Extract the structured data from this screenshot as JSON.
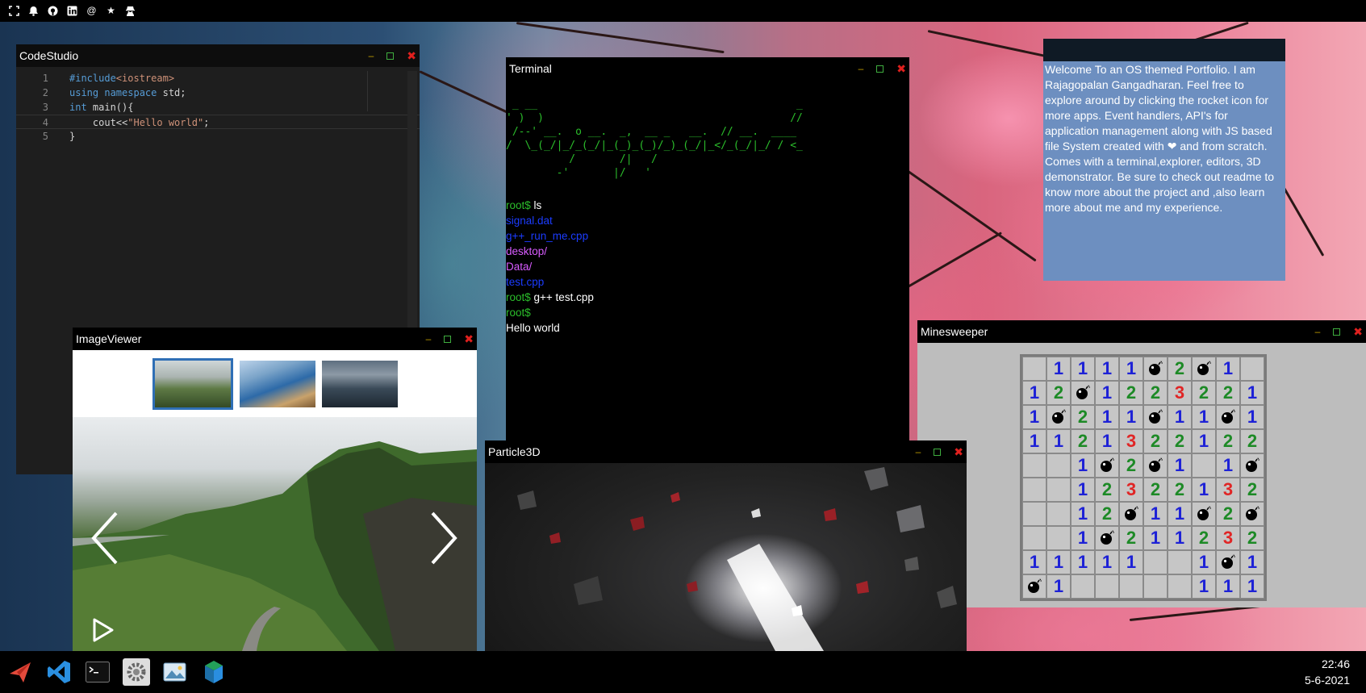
{
  "topbar": {
    "icons": [
      "fullscreen-icon",
      "bell-icon",
      "github-icon",
      "linkedin-icon",
      "at-icon",
      "star-icon",
      "spy-icon"
    ]
  },
  "windows": {
    "codestudio": {
      "title": "CodeStudio",
      "lines": [
        {
          "n": "1"
        },
        {
          "n": "2"
        },
        {
          "n": "3"
        },
        {
          "n": "4"
        },
        {
          "n": "5"
        }
      ],
      "code": {
        "l1_a": "#include",
        "l1_b": "<iostream>",
        "l2_a": "using namespace",
        "l2_b": " std;",
        "l3_a": "int",
        "l3_b": " main(){",
        "l4_a": "    cout<<",
        "l4_b": "\"Hello world\"",
        "l4_c": ";",
        "l5_a": "}"
      }
    },
    "terminal": {
      "title": "Terminal",
      "ascii_art": " _ __                                         _\n' )  )                                       //\n /--' __.  o __.  _,  __ _   __.  // __.  ____\n/  \\_(_/|_/_(_/|_(_)_(_)/_)_(_/|_</_(_/|_/ / <_\n          /       /|   /\n        -'       |/   '",
      "lines": [
        {
          "prompt": "root$",
          "text": " ls"
        },
        {
          "file": "signal.dat"
        },
        {
          "file": "g++_run_me.cpp"
        },
        {
          "dir": "desktop/"
        },
        {
          "dir": "Data/"
        },
        {
          "file": "test.cpp"
        },
        {
          "prompt": "root$",
          "text": " g++ test.cpp"
        },
        {
          "prompt": "root$",
          "text": ""
        },
        {
          "output": "Hello world"
        }
      ]
    },
    "imageviewer": {
      "title": "ImageViewer"
    },
    "particle": {
      "title": "Particle3D"
    },
    "minesweeper": {
      "title": "Minesweeper",
      "board": [
        [
          "",
          "1",
          "1",
          "1",
          "1",
          "*",
          "2",
          "*",
          "1",
          ""
        ],
        [
          "1",
          "2",
          "*",
          "1",
          "2",
          "2",
          "3",
          "2",
          "2",
          "1"
        ],
        [
          "1",
          "*",
          "2",
          "1",
          "1",
          "*",
          "1",
          "1",
          "*",
          "1"
        ],
        [
          "1",
          "1",
          "2",
          "1",
          "3",
          "2",
          "2",
          "1",
          "2",
          "2"
        ],
        [
          "",
          "",
          "1",
          "*",
          "2",
          "*",
          "1",
          "",
          "1",
          "*"
        ],
        [
          "",
          "",
          "1",
          "2",
          "3",
          "2",
          "2",
          "1",
          "3",
          "2"
        ],
        [
          "",
          "",
          "1",
          "2",
          "*",
          "1",
          "1",
          "*",
          "2",
          "*"
        ],
        [
          "",
          "",
          "1",
          "*",
          "2",
          "1",
          "1",
          "2",
          "3",
          "2"
        ],
        [
          "1",
          "1",
          "1",
          "1",
          "1",
          "",
          "",
          "1",
          "*",
          "1"
        ],
        [
          "*",
          "1",
          "",
          "",
          "",
          "",
          "",
          "1",
          "1",
          "1"
        ]
      ]
    }
  },
  "note": {
    "text": "Welcome To an OS themed Portfolio. I am Rajagopalan Gangadharan. Feel free to explore around by clicking the rocket icon for more apps. Event handlers, API's for application management along with JS based file System created with ❤ and from scratch. Comes with a terminal,explorer, editors, 3D demonstrator. Be sure to check out readme to know more about the project and ,also learn more about me and my experience."
  },
  "taskbar": {
    "apps": [
      "rocket-icon",
      "vscode-icon",
      "terminal-icon",
      "settings-icon",
      "image-viewer-icon",
      "3d-icon"
    ],
    "time": "22:46",
    "date": "5-6-2021"
  },
  "colors": {
    "prompt": "#2bbd2b",
    "file": "#1b3cff",
    "dir": "#d85cff",
    "note_bg": "#6d8fc0",
    "mine_bg": "#bdbdbd"
  }
}
